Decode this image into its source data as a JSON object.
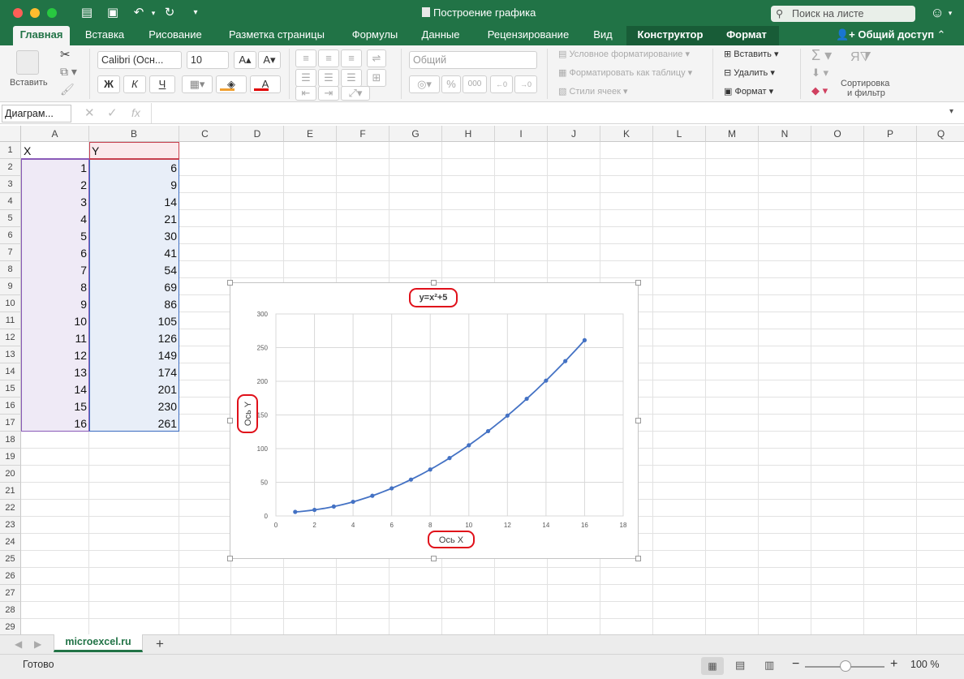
{
  "window": {
    "title": "Построение графика",
    "search_placeholder": "Поиск на листе"
  },
  "tabs": [
    {
      "label": "Главная",
      "active": true
    },
    {
      "label": "Вставка"
    },
    {
      "label": "Рисование"
    },
    {
      "label": "Разметка страницы"
    },
    {
      "label": "Формулы"
    },
    {
      "label": "Данные"
    },
    {
      "label": "Рецензирование"
    },
    {
      "label": "Вид"
    },
    {
      "label": "Конструктор"
    },
    {
      "label": "Формат"
    }
  ],
  "share_label": "Общий доступ",
  "ribbon": {
    "paste_label": "Вставить",
    "font_name": "Calibri (Осн...",
    "font_size": "10",
    "bold": "Ж",
    "italic": "К",
    "underline": "Ч",
    "number_format": "Общий",
    "conditional_formatting": "Условное форматирование",
    "format_as_table": "Форматировать как таблицу",
    "cell_styles": "Стили ячеек",
    "insert": "Вставить",
    "delete": "Удалить",
    "format": "Формат",
    "sort_filter_line1": "Сортировка",
    "sort_filter_line2": "и фильтр",
    "percent": "%",
    "thousands": "000"
  },
  "formula_bar": {
    "name_box": "Диаграм...",
    "fx": "fx"
  },
  "columns": [
    "A",
    "B",
    "C",
    "D",
    "E",
    "F",
    "G",
    "H",
    "I",
    "J",
    "K",
    "L",
    "M",
    "N",
    "O",
    "P",
    "Q"
  ],
  "rows": [
    "1",
    "2",
    "3",
    "4",
    "5",
    "6",
    "7",
    "8",
    "9",
    "10",
    "11",
    "12",
    "13",
    "14",
    "15",
    "16",
    "17",
    "18",
    "19",
    "20",
    "21",
    "22",
    "23",
    "24",
    "25",
    "26",
    "27",
    "28",
    "29"
  ],
  "table": {
    "header_x": "X",
    "header_y": "Y",
    "x_values": [
      "1",
      "2",
      "3",
      "4",
      "5",
      "6",
      "7",
      "8",
      "9",
      "10",
      "11",
      "12",
      "13",
      "14",
      "15",
      "16"
    ],
    "y_values": [
      "6",
      "9",
      "14",
      "21",
      "30",
      "41",
      "54",
      "69",
      "86",
      "105",
      "126",
      "149",
      "174",
      "201",
      "230",
      "261"
    ]
  },
  "chart_data": {
    "type": "scatter",
    "title": "y=x²+5",
    "xlabel": "Ось X",
    "ylabel": "Ось Y",
    "x": [
      1,
      2,
      3,
      4,
      5,
      6,
      7,
      8,
      9,
      10,
      11,
      12,
      13,
      14,
      15,
      16
    ],
    "y": [
      6,
      9,
      14,
      21,
      30,
      41,
      54,
      69,
      86,
      105,
      126,
      149,
      174,
      201,
      230,
      261
    ],
    "trendline": true,
    "xlim": [
      0,
      18
    ],
    "ylim": [
      0,
      300
    ],
    "x_ticks": [
      "0",
      "2",
      "4",
      "6",
      "8",
      "10",
      "12",
      "14",
      "16",
      "18"
    ],
    "y_ticks": [
      "0",
      "50",
      "100",
      "150",
      "200",
      "250",
      "300"
    ],
    "grid": true,
    "series_color": "#4472c4"
  },
  "sheet_tab": "microexcel.ru",
  "add_sheet": "+",
  "status": {
    "ready": "Готово",
    "zoom": "100 %"
  }
}
